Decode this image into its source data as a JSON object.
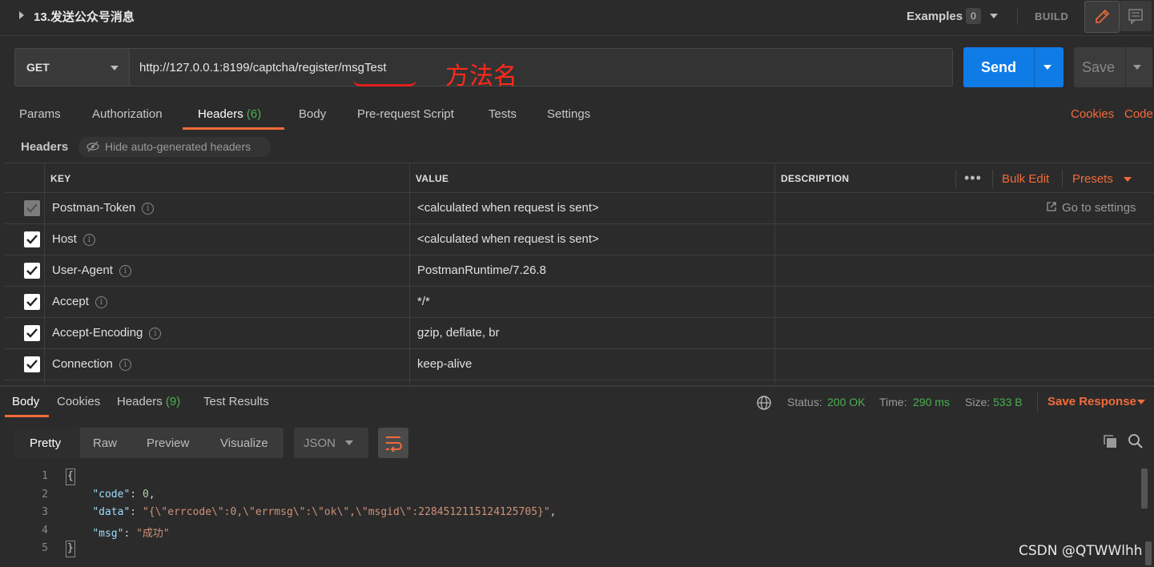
{
  "request": {
    "title": "13.发送公众号消息",
    "examples_label": "Examples",
    "examples_count": "0",
    "build_label": "BUILD",
    "method": "GET",
    "url": "http://127.0.0.1:8199/captcha/register/msgTest",
    "annotation": "方法名",
    "send_label": "Send",
    "save_label": "Save"
  },
  "request_tabs": [
    {
      "label": "Params"
    },
    {
      "label": "Authorization"
    },
    {
      "label": "Headers",
      "count": "(6)"
    },
    {
      "label": "Body"
    },
    {
      "label": "Pre-request Script"
    },
    {
      "label": "Tests"
    },
    {
      "label": "Settings"
    }
  ],
  "links": {
    "cookies": "Cookies",
    "code": "Code"
  },
  "headers_section": {
    "label": "Headers",
    "hide_auto": "Hide auto-generated headers"
  },
  "headers_table": {
    "columns": [
      "KEY",
      "VALUE",
      "DESCRIPTION"
    ],
    "more": "•••",
    "bulk_edit": "Bulk Edit",
    "presets": "Presets",
    "go_to_settings": "Go to settings",
    "rows": [
      {
        "key": "Postman-Token",
        "value": "<calculated when request is sent>",
        "checked": true,
        "disabled": true
      },
      {
        "key": "Host",
        "value": "<calculated when request is sent>",
        "checked": true
      },
      {
        "key": "User-Agent",
        "value": "PostmanRuntime/7.26.8",
        "checked": true
      },
      {
        "key": "Accept",
        "value": "*/*",
        "checked": true
      },
      {
        "key": "Accept-Encoding",
        "value": "gzip, deflate, br",
        "checked": true
      },
      {
        "key": "Connection",
        "value": "keep-alive",
        "checked": true
      }
    ]
  },
  "response": {
    "tabs": [
      {
        "label": "Body"
      },
      {
        "label": "Cookies"
      },
      {
        "label": "Headers",
        "count": "(9)"
      },
      {
        "label": "Test Results"
      }
    ],
    "status_label": "Status:",
    "status_value": "200 OK",
    "time_label": "Time:",
    "time_value": "290 ms",
    "size_label": "Size:",
    "size_value": "533 B",
    "save_response": "Save Response",
    "view_tabs": [
      "Pretty",
      "Raw",
      "Preview",
      "Visualize"
    ],
    "format": "JSON",
    "line_numbers": [
      "1",
      "2",
      "3",
      "4",
      "5"
    ],
    "code": {
      "open": "{",
      "code_key": "\"code\"",
      "code_val": "0",
      "data_key": "\"data\"",
      "data_val": "\"{\\\"errcode\\\":0,\\\"errmsg\\\":\\\"ok\\\",\\\"msgid\\\":2284512115124125705}\"",
      "msg_key": "\"msg\"",
      "msg_val": "\"成功\"",
      "close": "}"
    }
  },
  "watermark": "CSDN @QTWWlhh",
  "colors": {
    "accent": "#f26b3a",
    "send": "#0f7be5",
    "success": "#4caf50",
    "annotation": "#ff2a1a"
  }
}
